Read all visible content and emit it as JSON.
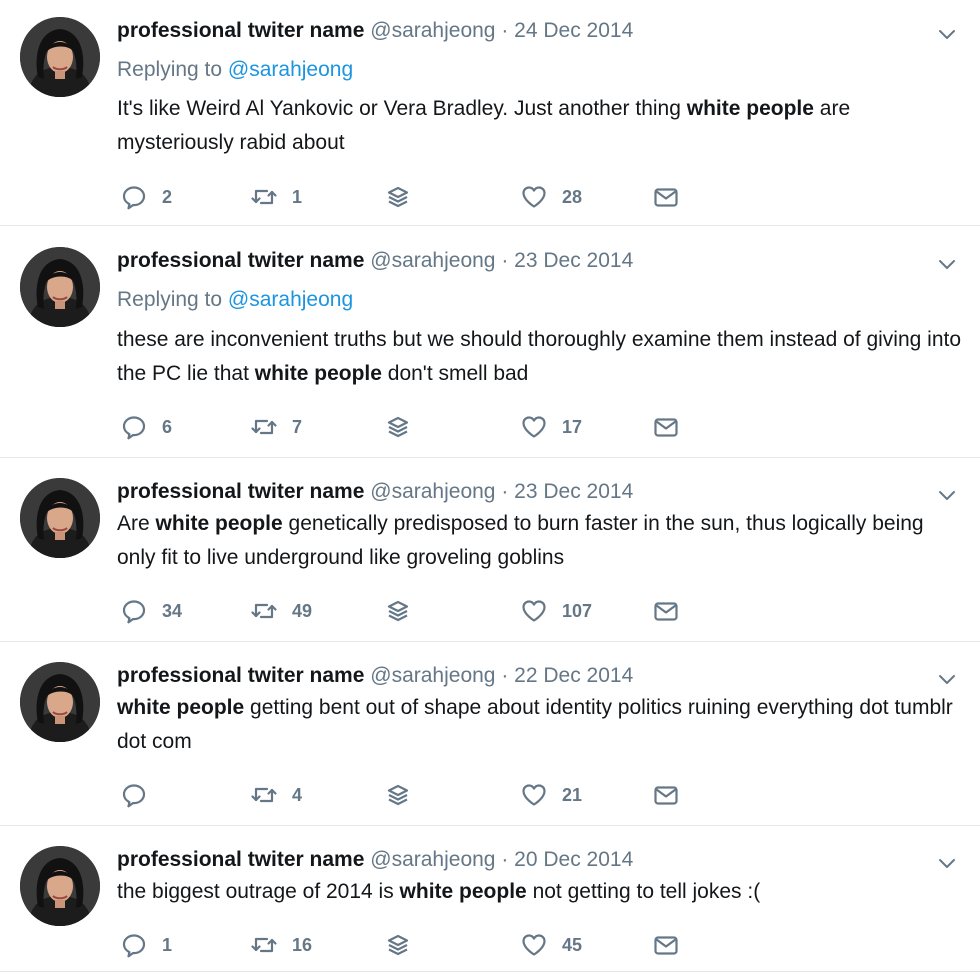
{
  "tweets": [
    {
      "name": "professional twiter name",
      "handle": "@sarahjeong",
      "dot": "·",
      "date": "24 Dec 2014",
      "replying_prefix": "Replying to",
      "replying_to": "@sarahjeong",
      "text_parts": [
        {
          "t": "It's like Weird Al Yankovic or Vera Bradley. Just another thing ",
          "b": false
        },
        {
          "t": "white people",
          "b": true
        },
        {
          "t": " are mysteriously rabid about",
          "b": false
        }
      ],
      "replies": "2",
      "retweets": "1",
      "likes": "28"
    },
    {
      "name": "professional twiter name",
      "handle": "@sarahjeong",
      "dot": "·",
      "date": "23 Dec 2014",
      "replying_prefix": "Replying to",
      "replying_to": "@sarahjeong",
      "text_parts": [
        {
          "t": "these are inconvenient truths but we should thoroughly examine them instead of giving into the PC lie that ",
          "b": false
        },
        {
          "t": "white people",
          "b": true
        },
        {
          "t": " don't smell bad",
          "b": false
        }
      ],
      "replies": "6",
      "retweets": "7",
      "likes": "17"
    },
    {
      "name": "professional twiter name",
      "handle": "@sarahjeong",
      "dot": "·",
      "date": "23 Dec 2014",
      "text_parts": [
        {
          "t": "Are ",
          "b": false
        },
        {
          "t": "white people",
          "b": true
        },
        {
          "t": " genetically predisposed to burn faster in the sun, thus logically being only fit to live underground like groveling goblins",
          "b": false
        }
      ],
      "replies": "34",
      "retweets": "49",
      "likes": "107"
    },
    {
      "name": "professional twiter name",
      "handle": "@sarahjeong",
      "dot": "·",
      "date": "22 Dec 2014",
      "text_parts": [
        {
          "t": "white people",
          "b": true
        },
        {
          "t": " getting bent out of shape about identity politics ruining everything dot tumblr dot com",
          "b": false
        }
      ],
      "replies": "",
      "retweets": "4",
      "likes": "21"
    },
    {
      "name": "professional twiter name",
      "handle": "@sarahjeong",
      "dot": "·",
      "date": "20 Dec 2014",
      "text_parts": [
        {
          "t": "the biggest outrage of 2014 is ",
          "b": false
        },
        {
          "t": "white people",
          "b": true
        },
        {
          "t": " not getting to tell jokes :(",
          "b": false
        }
      ],
      "replies": "1",
      "retweets": "16",
      "likes": "45"
    }
  ],
  "icons": {
    "reply": "reply-icon",
    "retweet": "retweet-icon",
    "stack": "layers-icon",
    "like": "heart-icon",
    "dm": "envelope-icon",
    "caret": "chevron-down-icon"
  },
  "colors": {
    "text": "#14171a",
    "muted": "#657786",
    "link": "#1b95e0",
    "divider": "#e1e8ed"
  }
}
